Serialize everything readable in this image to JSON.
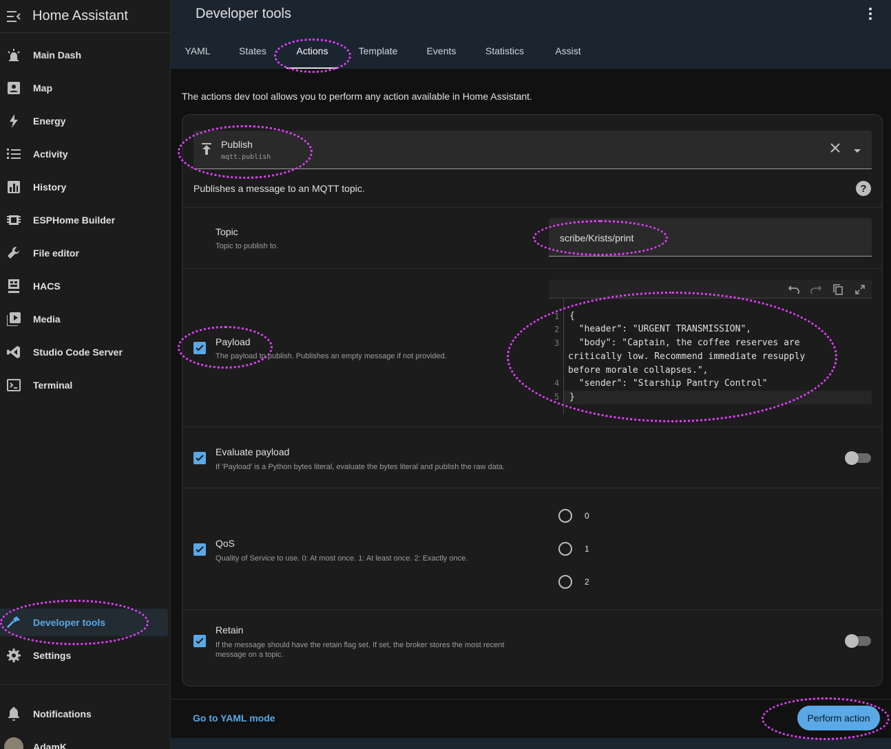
{
  "app": {
    "title": "Home Assistant"
  },
  "sidebar": {
    "items": [
      {
        "label": "Main Dash",
        "icon": "alarm-light-icon"
      },
      {
        "label": "Map",
        "icon": "account-box-icon"
      },
      {
        "label": "Energy",
        "icon": "lightning-bolt-icon"
      },
      {
        "label": "Activity",
        "icon": "format-list-bulleted-icon"
      },
      {
        "label": "History",
        "icon": "chart-box-icon"
      },
      {
        "label": "ESPHome Builder",
        "icon": "chip-icon"
      },
      {
        "label": "File editor",
        "icon": "wrench-icon"
      },
      {
        "label": "HACS",
        "icon": "hacs-icon"
      },
      {
        "label": "Media",
        "icon": "play-box-multiple-icon"
      },
      {
        "label": "Studio Code Server",
        "icon": "vscode-icon"
      },
      {
        "label": "Terminal",
        "icon": "console-icon"
      }
    ],
    "bottom_items": [
      {
        "label": "Developer tools",
        "icon": "hammer-icon",
        "active": true
      },
      {
        "label": "Settings",
        "icon": "cog-icon"
      }
    ],
    "notifications_label": "Notifications",
    "user_name": "AdamK"
  },
  "header": {
    "title": "Developer tools",
    "tabs": [
      "YAML",
      "States",
      "Actions",
      "Template",
      "Events",
      "Statistics",
      "Assist"
    ],
    "active_tab": "Actions"
  },
  "main": {
    "intro": "The actions dev tool allows you to perform any action available in Home Assistant.",
    "action": {
      "name": "Publish",
      "id": "mqtt.publish"
    },
    "action_description": "Publishes a message to an MQTT topic.",
    "fields": {
      "topic": {
        "label": "Topic",
        "description": "Topic to publish to.",
        "value": "scribe/Krists/print"
      },
      "payload": {
        "label": "Payload",
        "description": "The payload to publish. Publishes an empty message if not provided.",
        "checked": true,
        "line_numbers": [
          "1",
          "2",
          "3",
          "4",
          "5"
        ],
        "code_lines": [
          "{",
          "  \"header\": \"URGENT TRANSMISSION\",",
          "  \"body\": \"Captain, the coffee reserves are",
          "critically low. Recommend immediate resupply",
          "before morale collapses.\",",
          "  \"sender\": \"Starship Pantry Control\"",
          "}"
        ]
      },
      "evaluate_payload": {
        "label": "Evaluate payload",
        "description": "If 'Payload' is a Python bytes literal, evaluate the bytes literal and publish the raw data.",
        "checked": true,
        "toggle_on": false
      },
      "qos": {
        "label": "QoS",
        "description": "Quality of Service to use. 0: At most once. 1: At least once. 2: Exactly once.",
        "checked": true,
        "options": [
          "0",
          "1",
          "2"
        ]
      },
      "retain": {
        "label": "Retain",
        "description_line1": "If the message should have the retain flag set. If set, the broker stores the most recent",
        "description_line2": "message on a topic.",
        "checked": true,
        "toggle_on": false
      }
    }
  },
  "footer": {
    "yaml_mode_label": "Go to YAML mode",
    "perform_label": "Perform action"
  },
  "colors": {
    "accent": "#5aa9e6",
    "annotation": "#e040fb",
    "header_bg": "#1b2530"
  }
}
